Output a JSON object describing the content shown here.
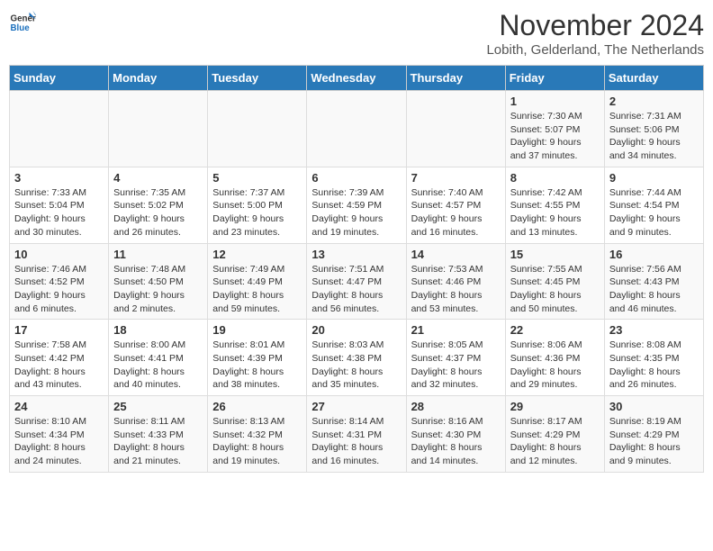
{
  "logo": {
    "general": "General",
    "blue": "Blue"
  },
  "title": "November 2024",
  "location": "Lobith, Gelderland, The Netherlands",
  "days_of_week": [
    "Sunday",
    "Monday",
    "Tuesday",
    "Wednesday",
    "Thursday",
    "Friday",
    "Saturday"
  ],
  "weeks": [
    [
      {
        "day": "",
        "info": ""
      },
      {
        "day": "",
        "info": ""
      },
      {
        "day": "",
        "info": ""
      },
      {
        "day": "",
        "info": ""
      },
      {
        "day": "",
        "info": ""
      },
      {
        "day": "1",
        "info": "Sunrise: 7:30 AM\nSunset: 5:07 PM\nDaylight: 9 hours and 37 minutes."
      },
      {
        "day": "2",
        "info": "Sunrise: 7:31 AM\nSunset: 5:06 PM\nDaylight: 9 hours and 34 minutes."
      }
    ],
    [
      {
        "day": "3",
        "info": "Sunrise: 7:33 AM\nSunset: 5:04 PM\nDaylight: 9 hours and 30 minutes."
      },
      {
        "day": "4",
        "info": "Sunrise: 7:35 AM\nSunset: 5:02 PM\nDaylight: 9 hours and 26 minutes."
      },
      {
        "day": "5",
        "info": "Sunrise: 7:37 AM\nSunset: 5:00 PM\nDaylight: 9 hours and 23 minutes."
      },
      {
        "day": "6",
        "info": "Sunrise: 7:39 AM\nSunset: 4:59 PM\nDaylight: 9 hours and 19 minutes."
      },
      {
        "day": "7",
        "info": "Sunrise: 7:40 AM\nSunset: 4:57 PM\nDaylight: 9 hours and 16 minutes."
      },
      {
        "day": "8",
        "info": "Sunrise: 7:42 AM\nSunset: 4:55 PM\nDaylight: 9 hours and 13 minutes."
      },
      {
        "day": "9",
        "info": "Sunrise: 7:44 AM\nSunset: 4:54 PM\nDaylight: 9 hours and 9 minutes."
      }
    ],
    [
      {
        "day": "10",
        "info": "Sunrise: 7:46 AM\nSunset: 4:52 PM\nDaylight: 9 hours and 6 minutes."
      },
      {
        "day": "11",
        "info": "Sunrise: 7:48 AM\nSunset: 4:50 PM\nDaylight: 9 hours and 2 minutes."
      },
      {
        "day": "12",
        "info": "Sunrise: 7:49 AM\nSunset: 4:49 PM\nDaylight: 8 hours and 59 minutes."
      },
      {
        "day": "13",
        "info": "Sunrise: 7:51 AM\nSunset: 4:47 PM\nDaylight: 8 hours and 56 minutes."
      },
      {
        "day": "14",
        "info": "Sunrise: 7:53 AM\nSunset: 4:46 PM\nDaylight: 8 hours and 53 minutes."
      },
      {
        "day": "15",
        "info": "Sunrise: 7:55 AM\nSunset: 4:45 PM\nDaylight: 8 hours and 50 minutes."
      },
      {
        "day": "16",
        "info": "Sunrise: 7:56 AM\nSunset: 4:43 PM\nDaylight: 8 hours and 46 minutes."
      }
    ],
    [
      {
        "day": "17",
        "info": "Sunrise: 7:58 AM\nSunset: 4:42 PM\nDaylight: 8 hours and 43 minutes."
      },
      {
        "day": "18",
        "info": "Sunrise: 8:00 AM\nSunset: 4:41 PM\nDaylight: 8 hours and 40 minutes."
      },
      {
        "day": "19",
        "info": "Sunrise: 8:01 AM\nSunset: 4:39 PM\nDaylight: 8 hours and 38 minutes."
      },
      {
        "day": "20",
        "info": "Sunrise: 8:03 AM\nSunset: 4:38 PM\nDaylight: 8 hours and 35 minutes."
      },
      {
        "day": "21",
        "info": "Sunrise: 8:05 AM\nSunset: 4:37 PM\nDaylight: 8 hours and 32 minutes."
      },
      {
        "day": "22",
        "info": "Sunrise: 8:06 AM\nSunset: 4:36 PM\nDaylight: 8 hours and 29 minutes."
      },
      {
        "day": "23",
        "info": "Sunrise: 8:08 AM\nSunset: 4:35 PM\nDaylight: 8 hours and 26 minutes."
      }
    ],
    [
      {
        "day": "24",
        "info": "Sunrise: 8:10 AM\nSunset: 4:34 PM\nDaylight: 8 hours and 24 minutes."
      },
      {
        "day": "25",
        "info": "Sunrise: 8:11 AM\nSunset: 4:33 PM\nDaylight: 8 hours and 21 minutes."
      },
      {
        "day": "26",
        "info": "Sunrise: 8:13 AM\nSunset: 4:32 PM\nDaylight: 8 hours and 19 minutes."
      },
      {
        "day": "27",
        "info": "Sunrise: 8:14 AM\nSunset: 4:31 PM\nDaylight: 8 hours and 16 minutes."
      },
      {
        "day": "28",
        "info": "Sunrise: 8:16 AM\nSunset: 4:30 PM\nDaylight: 8 hours and 14 minutes."
      },
      {
        "day": "29",
        "info": "Sunrise: 8:17 AM\nSunset: 4:29 PM\nDaylight: 8 hours and 12 minutes."
      },
      {
        "day": "30",
        "info": "Sunrise: 8:19 AM\nSunset: 4:29 PM\nDaylight: 8 hours and 9 minutes."
      }
    ]
  ]
}
